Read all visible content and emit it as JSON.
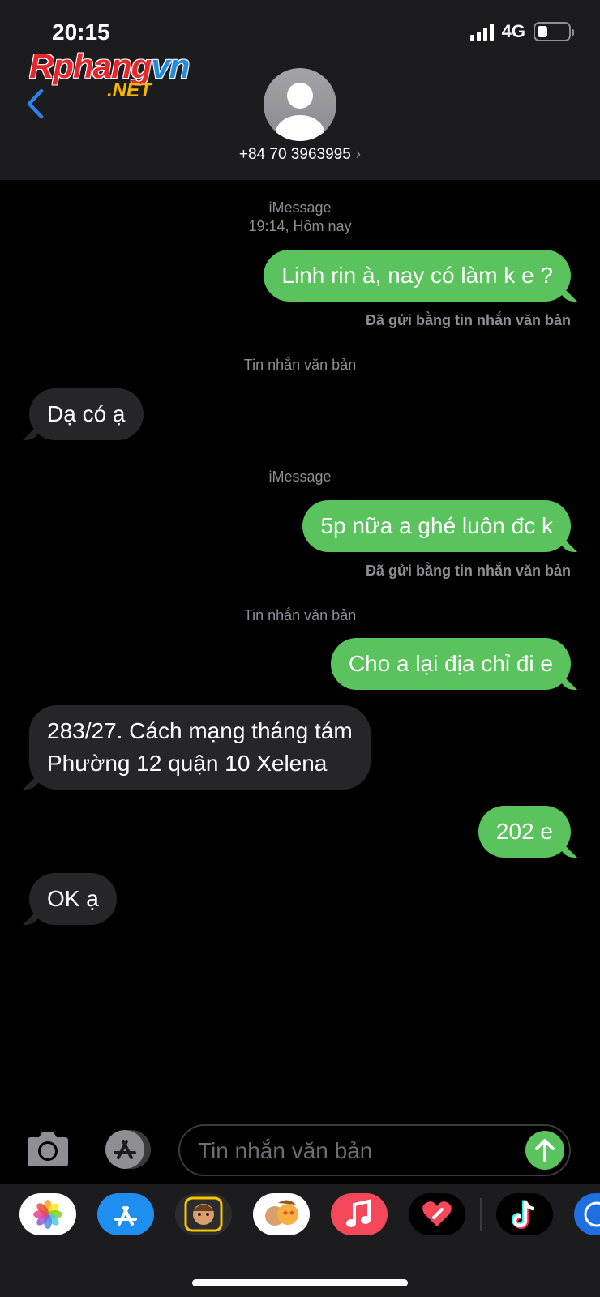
{
  "status_bar": {
    "time": "20:15",
    "network": "4G"
  },
  "watermark": {
    "main_a": "Rphang",
    "main_b": "vn",
    "sub": ".NET"
  },
  "header": {
    "contact": "+84 70 3963995",
    "chevron": "›"
  },
  "messages": [
    {
      "type": "meta",
      "lines": [
        "iMessage",
        "19:14, Hôm nay"
      ]
    },
    {
      "type": "out",
      "text": "Linh rin à, nay có làm k e ?"
    },
    {
      "type": "status",
      "text": "Đã gửi bằng tin nhắn văn bản"
    },
    {
      "type": "meta",
      "lines": [
        "Tin nhắn văn bản"
      ]
    },
    {
      "type": "in",
      "text": "Dạ có ạ"
    },
    {
      "type": "meta",
      "lines": [
        "iMessage"
      ]
    },
    {
      "type": "out",
      "text": "5p nữa a ghé luôn đc k"
    },
    {
      "type": "status",
      "text": "Đã gửi bằng tin nhắn văn bản"
    },
    {
      "type": "meta",
      "lines": [
        "Tin nhắn văn bản"
      ]
    },
    {
      "type": "out",
      "text": "Cho a lại địa chỉ đi e"
    },
    {
      "type": "in",
      "lines": [
        "283/27. Cách mạng tháng tám",
        "Phường 12 quận 10 Xelena"
      ]
    },
    {
      "type": "out",
      "text": "202 e"
    },
    {
      "type": "in",
      "text": "OK ạ"
    }
  ],
  "input": {
    "placeholder": "Tin nhắn văn bản"
  },
  "tray_apps": [
    {
      "name": "photos-app",
      "icon": "photos-icon",
      "color": "#ffffff"
    },
    {
      "name": "app-store-app",
      "icon": "app-store-icon",
      "color": "#1e8ef0"
    },
    {
      "name": "memoji-app",
      "icon": "memoji-icon",
      "color": "#1c1c1e"
    },
    {
      "name": "animoji-stickers-app",
      "icon": "animoji-icon",
      "color": "#ffffff"
    },
    {
      "name": "music-app",
      "icon": "music-icon",
      "color": "#f4485a"
    },
    {
      "name": "digital-touch-app",
      "icon": "heart-icon",
      "color": "#000000"
    },
    {
      "name": "tiktok-app",
      "icon": "tiktok-icon",
      "color": "#000000"
    },
    {
      "name": "partial-app",
      "icon": "app-icon",
      "color": "#1e6fe0"
    }
  ],
  "colors": {
    "outgoing": "#5ac35e",
    "incoming": "#262628",
    "accent": "#2f80ed"
  }
}
